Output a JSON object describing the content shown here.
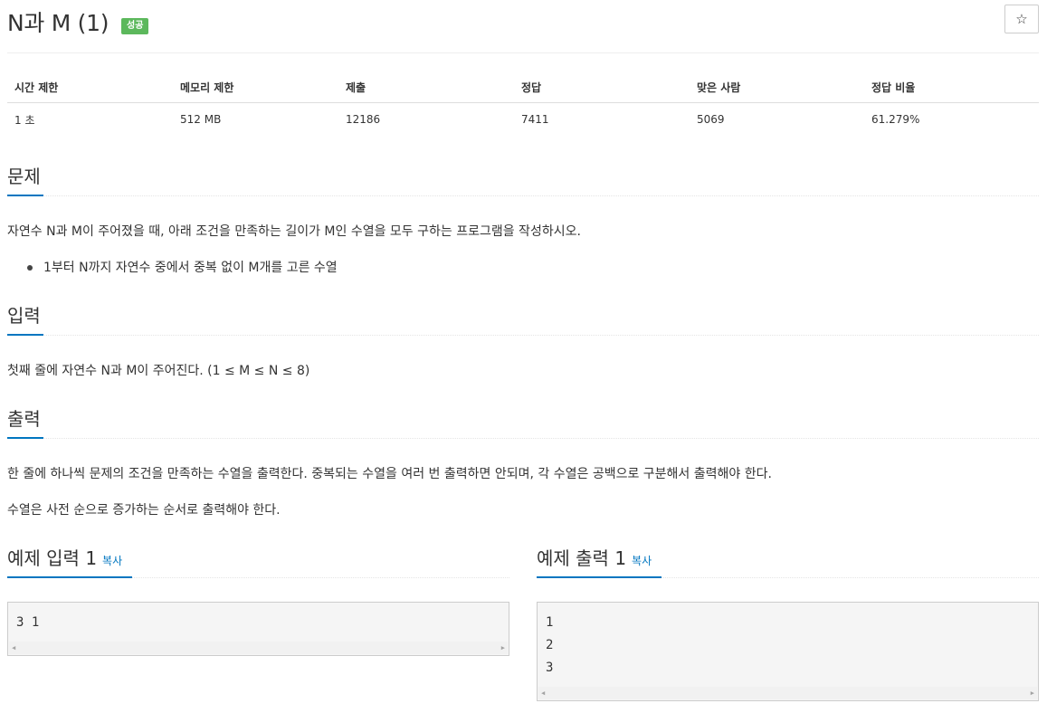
{
  "problem": {
    "title": "N과 M (1)",
    "badge": "성공",
    "star_icon": "☆"
  },
  "info": {
    "headers": [
      "시간 제한",
      "메모리 제한",
      "제출",
      "정답",
      "맞은 사람",
      "정답 비율"
    ],
    "values": [
      "1 초",
      "512 MB",
      "12186",
      "7411",
      "5069",
      "61.279%"
    ]
  },
  "description": {
    "heading": "문제",
    "text": "자연수 N과 M이 주어졌을 때, 아래 조건을 만족하는 길이가 M인 수열을 모두 구하는 프로그램을 작성하시오.",
    "bullets": [
      "1부터 N까지 자연수 중에서 중복 없이 M개를 고른 수열"
    ]
  },
  "input": {
    "heading": "입력",
    "text": "첫째 줄에 자연수 N과 M이 주어진다. (1 ≤ M ≤ N ≤ 8)"
  },
  "output": {
    "heading": "출력",
    "text1": "한 줄에 하나씩 문제의 조건을 만족하는 수열을 출력한다. 중복되는 수열을 여러 번 출력하면 안되며, 각 수열은 공백으로 구분해서 출력해야 한다.",
    "text2": "수열은 사전 순으로 증가하는 순서로 출력해야 한다."
  },
  "samples": {
    "input": {
      "heading": "예제 입력 1",
      "copy_label": "복사",
      "content": "3 1"
    },
    "output": {
      "heading": "예제 출력 1",
      "copy_label": "복사",
      "content": "1\n2\n3"
    },
    "scroll_left_icon": "◀",
    "scroll_right_icon": "▶"
  },
  "colors": {
    "accent": "#0076c0",
    "success_badge": "#5cb85c"
  }
}
